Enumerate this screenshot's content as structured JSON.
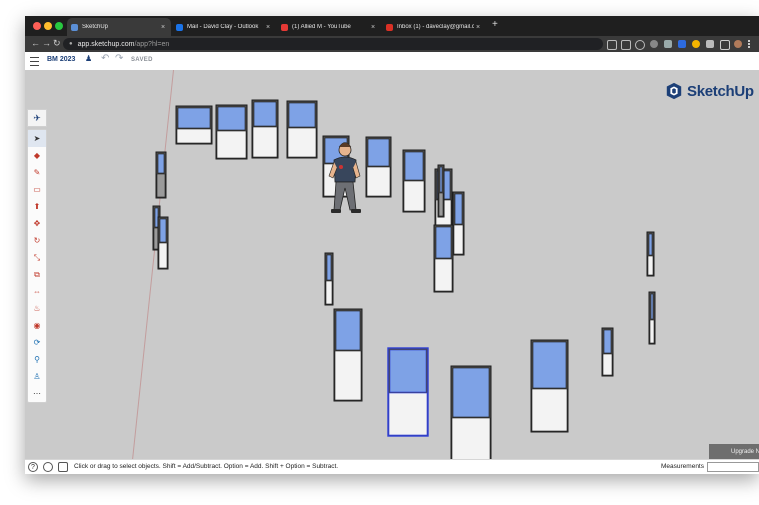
{
  "browser": {
    "tabs": [
      {
        "label": "SketchUp",
        "favicon_color": "#5b8fd6",
        "active": true
      },
      {
        "label": "Mail - David Clay - Outlook",
        "favicon_color": "#1a73e8",
        "active": false
      },
      {
        "label": "(1) Allied M - YouTube",
        "favicon_color": "#e53935",
        "active": false
      },
      {
        "label": "Inbox (1) - daveclay@gmail.co",
        "favicon_color": "#d93025",
        "active": false
      }
    ],
    "new_tab": "+",
    "close_glyph": "×",
    "back_glyph": "←",
    "forward_glyph": "→",
    "reload_glyph": "↻",
    "url_host": "app.sketchup.com",
    "url_path": "/app?hl=en"
  },
  "app": {
    "model_name": "BM 2023",
    "undo": "↶",
    "redo": "↷",
    "save_status": "SAVED",
    "brand": "SketchUp",
    "upgrade_label": "Upgrade N",
    "colors": {
      "brand": "#1c3f77",
      "glass": "#7ea2e6",
      "selection": "#2f3fd6",
      "canvas": "#cacaca"
    }
  },
  "toolbar": {
    "top_icon": "✈",
    "tools": [
      {
        "name": "select-tool-icon",
        "glyph": "➤",
        "selected": true
      },
      {
        "name": "eraser-tool-icon",
        "glyph": "◆"
      },
      {
        "name": "pencil-tool-icon",
        "glyph": "✎"
      },
      {
        "name": "rectangle-tool-icon",
        "glyph": "▭"
      },
      {
        "name": "push-pull-tool-icon",
        "glyph": "⬆"
      },
      {
        "name": "move-tool-icon",
        "glyph": "✥"
      },
      {
        "name": "rotate-tool-icon",
        "glyph": "↻"
      },
      {
        "name": "scale-tool-icon",
        "glyph": "⤡"
      },
      {
        "name": "offset-tool-icon",
        "glyph": "⧉"
      },
      {
        "name": "tape-measure-tool-icon",
        "glyph": "⇔"
      },
      {
        "name": "paint-bucket-tool-icon",
        "glyph": "♨"
      },
      {
        "name": "text-tool-icon",
        "glyph": "◉"
      },
      {
        "name": "orbit-tool-icon",
        "glyph": "⟳"
      },
      {
        "name": "zoom-tool-icon",
        "glyph": "⚲"
      },
      {
        "name": "walk-tool-icon",
        "glyph": "♙"
      },
      {
        "name": "more-tools-icon",
        "glyph": "⋯"
      }
    ]
  },
  "statusbar": {
    "hint": "Click or drag to select objects. Shift = Add/Subtract. Option = Add. Shift + Option = Subtract.",
    "help": "?",
    "measurements_label": "Measurements"
  }
}
